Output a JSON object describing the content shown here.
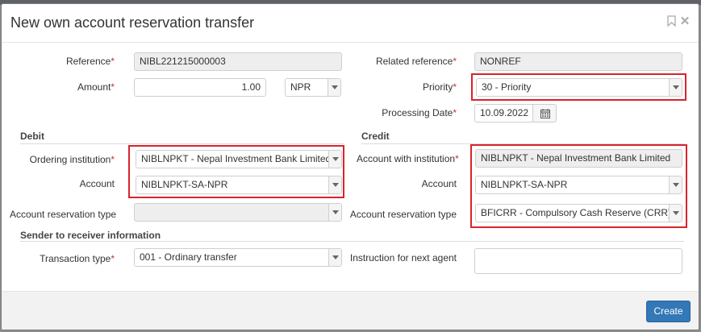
{
  "modal": {
    "title": "New own account reservation transfer",
    "bookmark_icon": "bookmark-icon",
    "close_icon": "close-icon"
  },
  "fields": {
    "reference": {
      "label": "Reference",
      "value": "NIBL221215000003"
    },
    "amount": {
      "label": "Amount",
      "value": "1.00",
      "currency": "NPR"
    },
    "related_reference": {
      "label": "Related reference",
      "value": "NONREF"
    },
    "priority": {
      "label": "Priority",
      "value": "30 - Priority"
    },
    "processing_date": {
      "label": "Processing Date",
      "value": "10.09.2022",
      "icon": "calendar-icon"
    }
  },
  "debit": {
    "section_title": "Debit",
    "ordering_institution": {
      "label": "Ordering institution",
      "value": "NIBLNPKT - Nepal Investment Bank Limited"
    },
    "account": {
      "label": "Account",
      "value": "NIBLNPKT-SA-NPR"
    },
    "reservation_type": {
      "label": "Account reservation type",
      "value": ""
    }
  },
  "credit": {
    "section_title": "Credit",
    "account_with_institution": {
      "label": "Account with institution",
      "value": "NIBLNPKT - Nepal Investment Bank Limited"
    },
    "account": {
      "label": "Account",
      "value": "NIBLNPKT-SA-NPR"
    },
    "reservation_type": {
      "label": "Account reservation type",
      "value": "BFICRR - Compulsory Cash Reserve (CRR)"
    }
  },
  "sender_info": {
    "section_title": "Sender to receiver information",
    "transaction_type": {
      "label": "Transaction type",
      "value": "001 - Ordinary transfer"
    },
    "instruction": {
      "label": "Instruction for next agent",
      "value": ""
    }
  },
  "footer": {
    "create_label": "Create"
  },
  "colors": {
    "highlight": "#d9232d",
    "primary": "#3378b7",
    "required": "#c9302c"
  }
}
